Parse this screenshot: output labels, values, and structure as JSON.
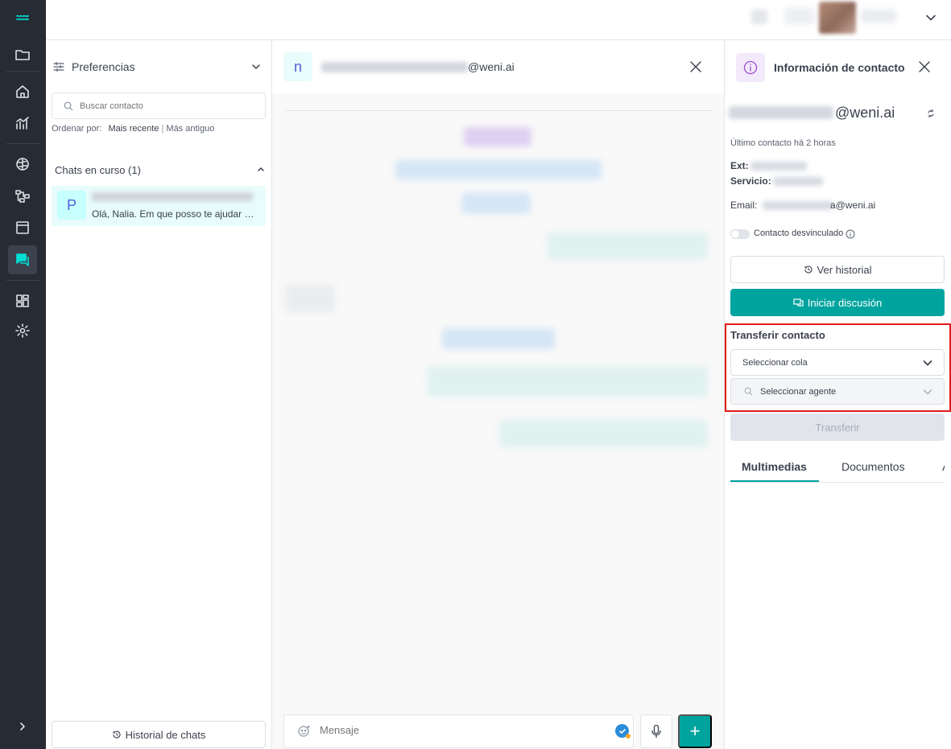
{
  "rail": {
    "icons": [
      "weni-logo-icon",
      "folder-icon",
      "home-icon",
      "chart-icon",
      "brain-icon",
      "flow-icon",
      "browser-icon",
      "chats-icon",
      "dashboard-icon",
      "gear-icon",
      "expand-icon"
    ]
  },
  "chatlist": {
    "preferences_label": "Preferencias",
    "search_placeholder": "Buscar contacto",
    "order_label": "Ordenar por:",
    "order_recent": "Mais recente",
    "order_separator": "|",
    "order_oldest": "Más antiguo",
    "ongoing_label": "Chats en curso (1)",
    "chats": [
      {
        "avatar": "P",
        "last_message": "Olá, Nalia. Em que posso te ajudar hoje?"
      }
    ],
    "history_button": "Historial de chats"
  },
  "conversation": {
    "avatar": "n",
    "contact_domain": "@weni.ai",
    "composer_placeholder": "Mensaje",
    "plus_symbol": "+"
  },
  "info": {
    "title": "Información de contacto",
    "contact_domain": "@weni.ai",
    "last_contact": "Último contacto há 2 horas",
    "ext_label": "Ext:",
    "service_label": "Servicio:",
    "email_label": "Email:",
    "email_domain": "a@weni.ai",
    "unlinked_label": "Contacto desvinculado",
    "history_button": "Ver historial",
    "discussion_button": "Iniciar discusión",
    "transfer_title": "Transferir contacto",
    "queue_select": "Seleccionar cola",
    "agent_select": "Seleccionar agente",
    "transfer_button": "Transferir",
    "tabs": [
      "Multimedias",
      "Documentos",
      "A"
    ]
  },
  "colors": {
    "rail_bg": "#272b33",
    "accent": "#00a49f",
    "highlight_border": "#e01b1b"
  }
}
